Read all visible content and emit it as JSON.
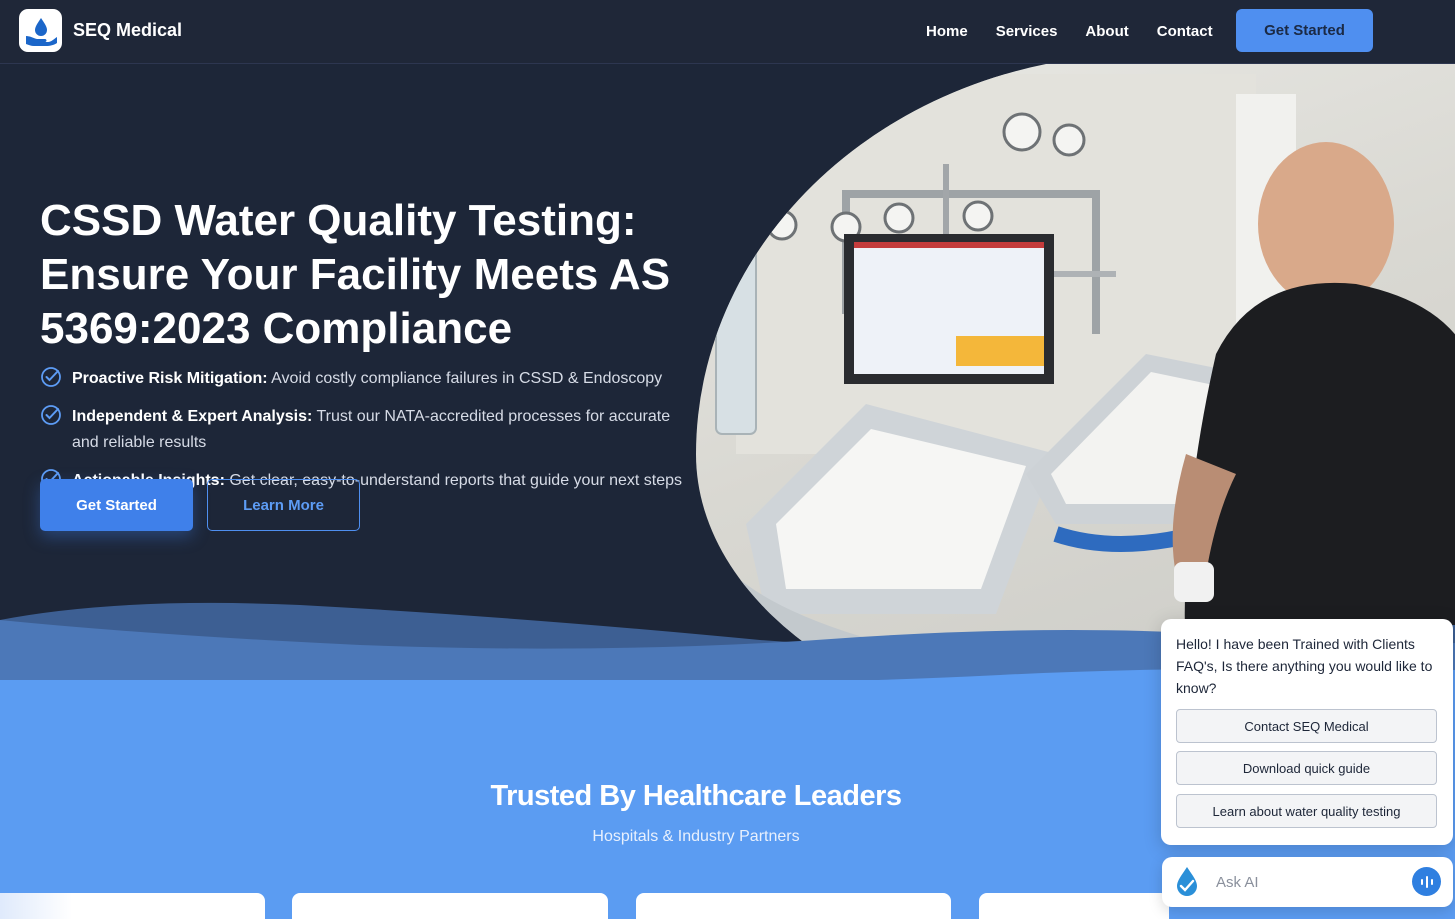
{
  "nav": {
    "brand": "SEQ Medical",
    "links": [
      "Home",
      "Services",
      "About",
      "Contact"
    ],
    "cta": "Get Started"
  },
  "hero": {
    "title": "CSSD Water Quality Testing: Ensure Your Facility Meets AS 5369:2023 Compliance",
    "bullets": [
      {
        "bold": "Proactive Risk Mitigation:",
        "text": " Avoid costly compliance failures in CSSD & Endoscopy"
      },
      {
        "bold": "Independent & Expert Analysis:",
        "text": " Trust our NATA-accredited processes for accurate and reliable results"
      },
      {
        "bold": "Actionable Insights:",
        "text": " Get clear, easy-to-understand reports that guide your next steps"
      }
    ],
    "primary_button": "Get Started",
    "secondary_button": "Learn More"
  },
  "trusted": {
    "title": "Trusted By Healthcare Leaders",
    "subtitle": "Hospitals & Industry Partners"
  },
  "chat": {
    "message": "Hello! I have been Trained with Clients FAQ's, Is there anything you would like to know?",
    "options": [
      "Contact SEQ Medical",
      "Download quick guide",
      "Learn about water quality testing"
    ],
    "input_placeholder": "Ask AI"
  },
  "colors": {
    "accent": "#3f80ea",
    "hero_bg": "#1d2638",
    "section_blue": "#5b9cf2"
  }
}
